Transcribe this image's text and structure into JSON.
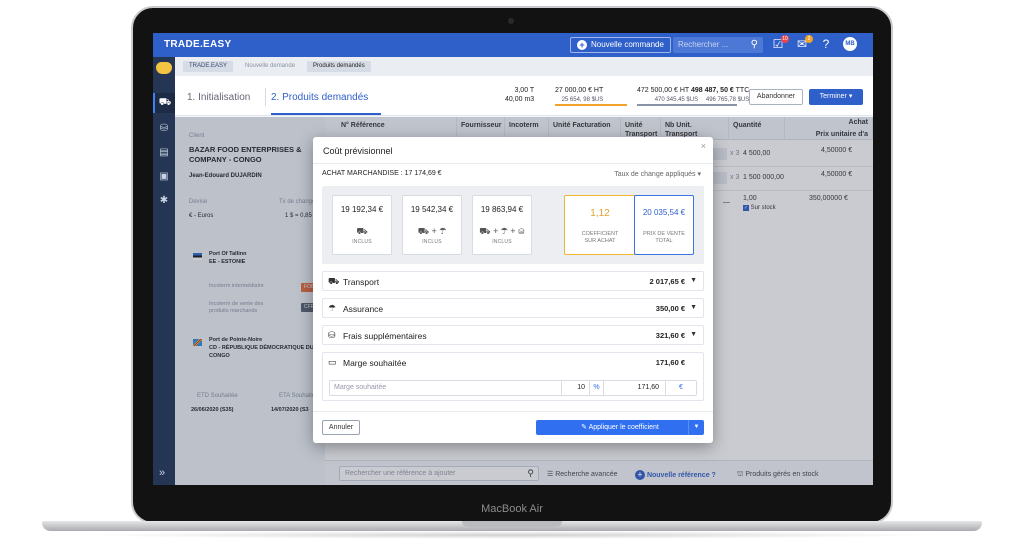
{
  "device": {
    "label": "MacBook Air"
  },
  "topbar": {
    "brand": "TRADE.EASY",
    "new_order": "Nouvelle commande",
    "search_placeholder": "Rechercher ...",
    "badge_1": "10",
    "badge_2": "2",
    "avatar": "MB"
  },
  "breadcrumb": [
    "TRADE.EASY",
    "Nouvelle demande",
    "Produits demandés"
  ],
  "steps": {
    "step1": "1. Initialisation",
    "step2": "2. Produits demandés",
    "tot1_a": "3,00 T",
    "tot1_b": "40,00 m3",
    "tot2_a": "27 000,00 € HT",
    "tot2_b": "25 654, 98 $US",
    "tot3_a": "472 500,00 € HT",
    "tot3_bold": "498 487, 50 €",
    "tot3_ttc": "TTC",
    "tot3_b1": "470 345,45 $US",
    "tot3_b2": "496 765,78 $US",
    "abandon": "Abandonner",
    "terminer": "Terminer"
  },
  "client": {
    "label": "Client",
    "name_1": "BAZAR FOOD ENTERPRISES &",
    "name_2": "COMPANY - CONGO",
    "contact": "Jean-Edouard DUJARDIN",
    "devise_label": "Devise",
    "tx_label": "Tx de change",
    "devise_value": "€ - Euros",
    "tx_value": "1 $ = 0,85",
    "port1_a": "Port Of Tallinn",
    "port1_b": "EE - ESTONIE",
    "incoterm_inter": "Incoterm intermédiaire",
    "incoterm_inter_tag": "FOB",
    "incoterm_vente_1": "Incoterm de vente des",
    "incoterm_vente_2": "produits marchands",
    "incoterm_vente_tag": "CFR",
    "port2_a": "Port de Pointe-Noire",
    "port2_b": "CD - RÉPUBLIQUE DÉMOCRATIQUE DU",
    "port2_c": "CONGO",
    "etd_label": "ETD Souhaitée",
    "eta_label": "ETA Souhaitée",
    "etd_value": "26/06/2020 (S35)",
    "eta_value": "14/07/2020 (S3"
  },
  "table": {
    "headers": [
      "N° Référence",
      "Fournisseur",
      "Incoterm",
      "Unité Facturation",
      "Unité Transport",
      "Nb Unit. Transport",
      "Quantité",
      "Achat",
      "Prix unitaire d'a"
    ],
    "rows": [
      {
        "stepper": "000",
        "mult": "x  3",
        "qty": "4 500,00",
        "price": "4,50000 €"
      },
      {
        "stepper": "000",
        "mult": "x  3",
        "qty": "1 500 000,00",
        "price": "4,50000 €"
      },
      {
        "dash": "—",
        "qty": "1,00",
        "stock": "Sur stock",
        "price": "350,00000 €"
      }
    ]
  },
  "bottom": {
    "search_placeholder": "Rechercher une référence à ajouter",
    "advanced": "Recherche avancée",
    "new_ref": "Nouvelle référence ?",
    "stock": "Produits gérés en stock"
  },
  "modal": {
    "title": "Coût prévisionnel",
    "achat": "ACHAT MARCHANDISE : 17 174,69 €",
    "taux": "Taux de change appliqués",
    "cards": [
      {
        "amount": "19 192,34 €",
        "icons": "⛟",
        "label": "INCLUS"
      },
      {
        "amount": "19 542,34 €",
        "icons": "⛟ + ☂",
        "label": "INCLUS"
      },
      {
        "amount": "19 863,94 €",
        "icons": "⛟ + ☂ + ⛁",
        "label": "INCLUS"
      }
    ],
    "coef_value": "1,12",
    "coef_label_1": "COEFFICIENT",
    "coef_label_2": "SUR ACHAT",
    "total_value": "20 035,54 €",
    "total_label_1": "PRIX DE VENTE",
    "total_label_2": "TOTAL",
    "transport_label": "Transport",
    "transport_value": "2 017,65 €",
    "assurance_label": "Assurance",
    "assurance_value": "350,00 €",
    "frais_label": "Frais supplémentaires",
    "frais_value": "321,60 €",
    "marge_label": "Marge souhaitée",
    "marge_value": "171,60 €",
    "marge_input_label": "Marge souhaitée",
    "marge_pct": "10",
    "pct_symbol": "%",
    "marge_amount": "171,60",
    "eur_symbol": "€",
    "annuler": "Annuler",
    "appliquer": "Appliquer le coefficient"
  }
}
